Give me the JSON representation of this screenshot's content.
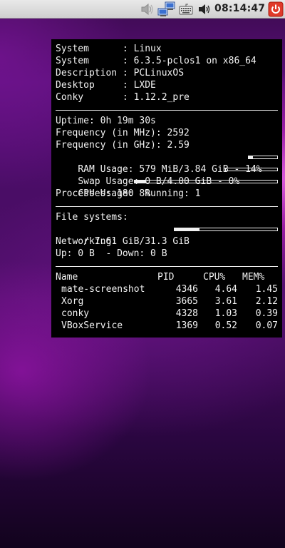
{
  "panel": {
    "clock": "08:14:47",
    "tray_icons": [
      "audio-speaker-icon",
      "network-computers-icon",
      "keyboard-icon",
      "volume-icon",
      "power-icon"
    ],
    "colors": {
      "power": "#e03a2a"
    }
  },
  "conky": {
    "system": [
      {
        "key": "System     ",
        "value": ": Linux"
      },
      {
        "key": "System     ",
        "value": ": 6.3.5-pclos1 on x86_64"
      },
      {
        "key": "Description",
        "value": ": PCLinuxOS"
      },
      {
        "key": "Desktop    ",
        "value": ": LXDE"
      },
      {
        "key": "Conky      ",
        "value": ": 1.12.2_pre"
      }
    ],
    "uptime": "Uptime: 0h 19m 30s",
    "freq_mhz": "Frequency (in MHz): 2592",
    "freq_ghz": "Frequency (in GHz): 2.59",
    "ram": {
      "text": "RAM Usage: 579 MiB/3.84 GiB - 14%",
      "percent": 14
    },
    "swap": {
      "text": "Swap Usage: 0 B/4.00 GiB - 0%",
      "percent": 0
    },
    "cpu": {
      "text": "CPU Usage: 8%",
      "percent": 8
    },
    "processes": "Processes: 180  Running: 1",
    "fs_title": "File systems:",
    "fs_root": {
      "text": " / 7.61 GiB/31.3 GiB",
      "percent": 24
    },
    "net_title": "Networking:",
    "net": "Up: 0 B  - Down: 0 B",
    "proc_headers": {
      "name": "Name",
      "pid": "PID",
      "cpu": "CPU%",
      "mem": "MEM%"
    },
    "processes_list": [
      {
        "name": "mate-screenshot",
        "pid": "4346",
        "cpu": "4.64",
        "mem": "1.45"
      },
      {
        "name": "Xorg",
        "pid": "3665",
        "cpu": "3.61",
        "mem": "2.12"
      },
      {
        "name": "conky",
        "pid": "4328",
        "cpu": "1.03",
        "mem": "0.39"
      },
      {
        "name": "VBoxService",
        "pid": "1369",
        "cpu": "0.52",
        "mem": "0.07"
      }
    ]
  }
}
